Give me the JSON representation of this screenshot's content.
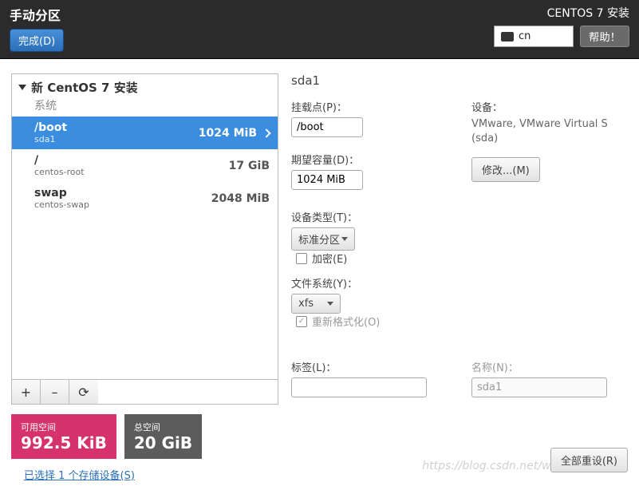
{
  "header": {
    "title": "手动分区",
    "done": "完成(D)",
    "right_title": "CENTOS 7 安装",
    "lang": "cn",
    "help": "帮助！"
  },
  "tree": {
    "title": "新 CentOS 7 安装",
    "system_label": "系统",
    "parts": [
      {
        "mount": "/boot",
        "dev": "sda1",
        "size": "1024 MiB",
        "selected": true
      },
      {
        "mount": "/",
        "dev": "centos-root",
        "size": "17 GiB",
        "selected": false
      },
      {
        "mount": "swap",
        "dev": "centos-swap",
        "size": "2048 MiB",
        "selected": false
      }
    ]
  },
  "buttons": {
    "add": "+",
    "remove": "–",
    "reload": "⟳"
  },
  "space": {
    "free_label": "可用空间",
    "free_value": "992.5 KiB",
    "total_label": "总空间",
    "total_value": "20 GiB"
  },
  "storage_link": "已选择 1 个存储设备(S)",
  "detail": {
    "title": "sda1",
    "mount_label": "挂载点(P)：",
    "mount_value": "/boot",
    "capacity_label": "期望容量(D)：",
    "capacity_value": "1024 MiB",
    "device_label": "设备：",
    "device_value": "VMware, VMware Virtual S (sda)",
    "modify_btn": "修改...(M)",
    "devtype_label": "设备类型(T)：",
    "devtype_value": "标准分区",
    "encrypt": "加密(E)",
    "fs_label": "文件系统(Y)：",
    "fs_value": "xfs",
    "reformat": "重新格式化(O)",
    "label_label": "标签(L)：",
    "label_value": "",
    "name_label": "名称(N)：",
    "name_value": "sda1"
  },
  "reset_all": "全部重设(R)",
  "watermark": "https://blog.csdn.net/weixin_"
}
